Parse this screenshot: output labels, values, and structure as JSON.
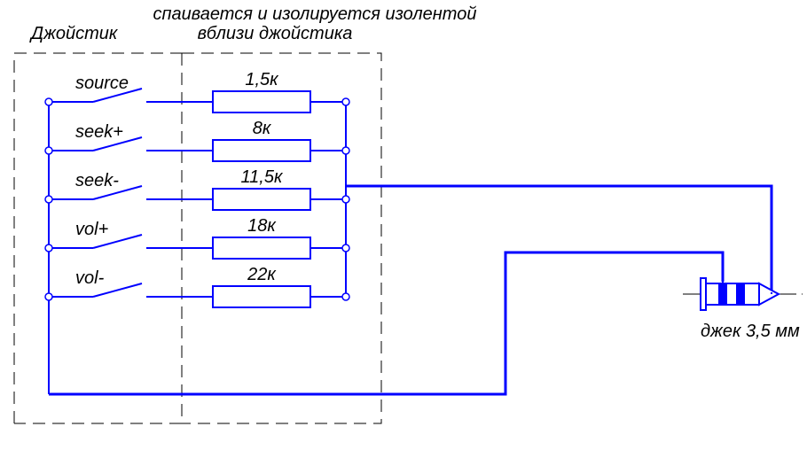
{
  "title_top": "спаивается и изолируется изолентой",
  "title_sub": "вблизи джойстика",
  "joystick_label": "Джойстик",
  "jack_label": "джек 3,5 мм",
  "rows": [
    {
      "switch": "source",
      "resistor": "1,5к"
    },
    {
      "switch": "seek+",
      "resistor": "8к"
    },
    {
      "switch": "seek-",
      "resistor": "11,5к"
    },
    {
      "switch": "vol+",
      "resistor": "18к"
    },
    {
      "switch": "vol-",
      "resistor": "22к"
    }
  ]
}
